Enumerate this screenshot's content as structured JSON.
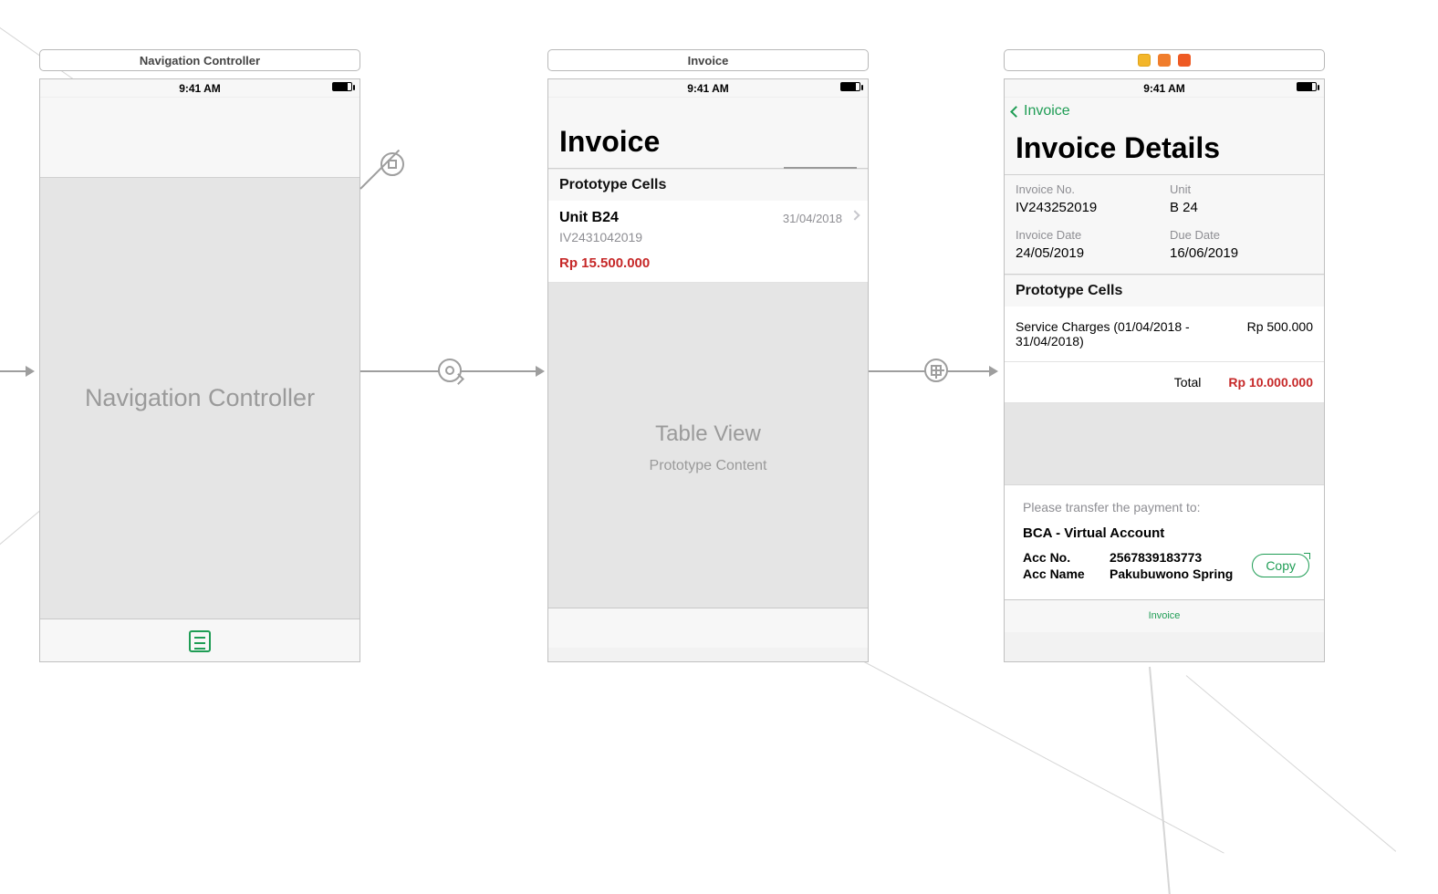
{
  "status_time": "9:41 AM",
  "scene1": {
    "label": "Navigation Controller",
    "body": "Navigation Controller"
  },
  "scene2": {
    "label": "Invoice",
    "title": "Invoice",
    "section_header": "Prototype Cells",
    "cell": {
      "unit": "Unit B24",
      "invoice_id": "IV2431042019",
      "date": "31/04/2018",
      "price": "Rp 15.500.000"
    },
    "table_title": "Table View",
    "table_sub": "Prototype Content"
  },
  "scene3": {
    "back_label": "Invoice",
    "title": "Invoice Details",
    "info": {
      "invoice_no_label": "Invoice No.",
      "invoice_no": "IV243252019",
      "unit_label": "Unit",
      "unit": "B 24",
      "invoice_date_label": "Invoice Date",
      "invoice_date": "24/05/2019",
      "due_date_label": "Due Date",
      "due_date": "16/06/2019"
    },
    "section_header": "Prototype Cells",
    "charge": {
      "desc": "Service Charges (01/04/2018 - 31/04/2018)",
      "amount": "Rp 500.000"
    },
    "total_label": "Total",
    "total_value": "Rp 10.000.000",
    "payment": {
      "instruction": "Please transfer the payment to:",
      "bank": "BCA - Virtual Account",
      "acc_no_label": "Acc No.",
      "acc_no": "2567839183773",
      "acc_name_label": "Acc Name",
      "acc_name": "Pakubuwono Spring",
      "copy_label": "Copy"
    },
    "tab_label": "Invoice"
  }
}
